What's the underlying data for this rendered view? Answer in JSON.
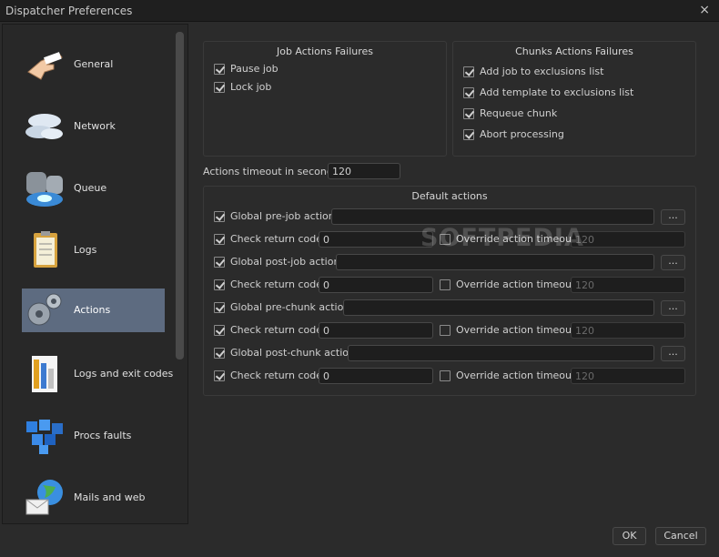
{
  "window": {
    "title": "Dispatcher Preferences",
    "close_glyph": "×"
  },
  "sidebar": {
    "items": [
      {
        "label": "General",
        "icon": "pointing-hand-icon"
      },
      {
        "label": "Network",
        "icon": "cloud-network-icon"
      },
      {
        "label": "Queue",
        "icon": "database-queue-icon"
      },
      {
        "label": "Logs",
        "icon": "clipboard-logs-icon"
      },
      {
        "label": "Actions",
        "icon": "gears-actions-icon",
        "active": true
      },
      {
        "label": "Logs and exit codes",
        "icon": "document-bars-icon"
      },
      {
        "label": "Procs faults",
        "icon": "cubes-faults-icon"
      },
      {
        "label": "Mails and web",
        "icon": "globe-mail-icon"
      }
    ]
  },
  "job_failures": {
    "title": "Job Actions Failures",
    "items": [
      {
        "label": "Pause job",
        "checked": true
      },
      {
        "label": "Lock job",
        "checked": true
      }
    ]
  },
  "chunk_failures": {
    "title": "Chunks Actions Failures",
    "items": [
      {
        "label": "Add job to exclusions list",
        "checked": true
      },
      {
        "label": "Add template to exclusions list",
        "checked": true
      },
      {
        "label": "Requeue chunk",
        "checked": true
      },
      {
        "label": "Abort processing",
        "checked": true
      }
    ]
  },
  "timeout": {
    "label": "Actions timeout in seconds:",
    "value": "120"
  },
  "default_actions": {
    "title": "Default actions",
    "browse_label": "...",
    "override_label": "Override action timeout:",
    "return_label": "Check return code:",
    "rows": [
      {
        "label": "Global pre-job action:",
        "checked": true,
        "value": "",
        "return_code": "0",
        "return_checked": true,
        "override_checked": false,
        "override_value": "120"
      },
      {
        "label": "Global post-job action:",
        "checked": true,
        "value": "",
        "return_code": "0",
        "return_checked": true,
        "override_checked": false,
        "override_value": "120"
      },
      {
        "label": "Global pre-chunk action:",
        "checked": true,
        "value": "",
        "return_code": "0",
        "return_checked": true,
        "override_checked": false,
        "override_value": "120"
      },
      {
        "label": "Global post-chunk action:",
        "checked": true,
        "value": "",
        "return_code": "0",
        "return_checked": true,
        "override_checked": false,
        "override_value": "120"
      }
    ]
  },
  "watermark": "SOFTPEDIA",
  "buttons": {
    "ok": "OK",
    "cancel": "Cancel"
  },
  "colors": {
    "active_item": "#5d6b80",
    "background": "#2b2b2b"
  }
}
